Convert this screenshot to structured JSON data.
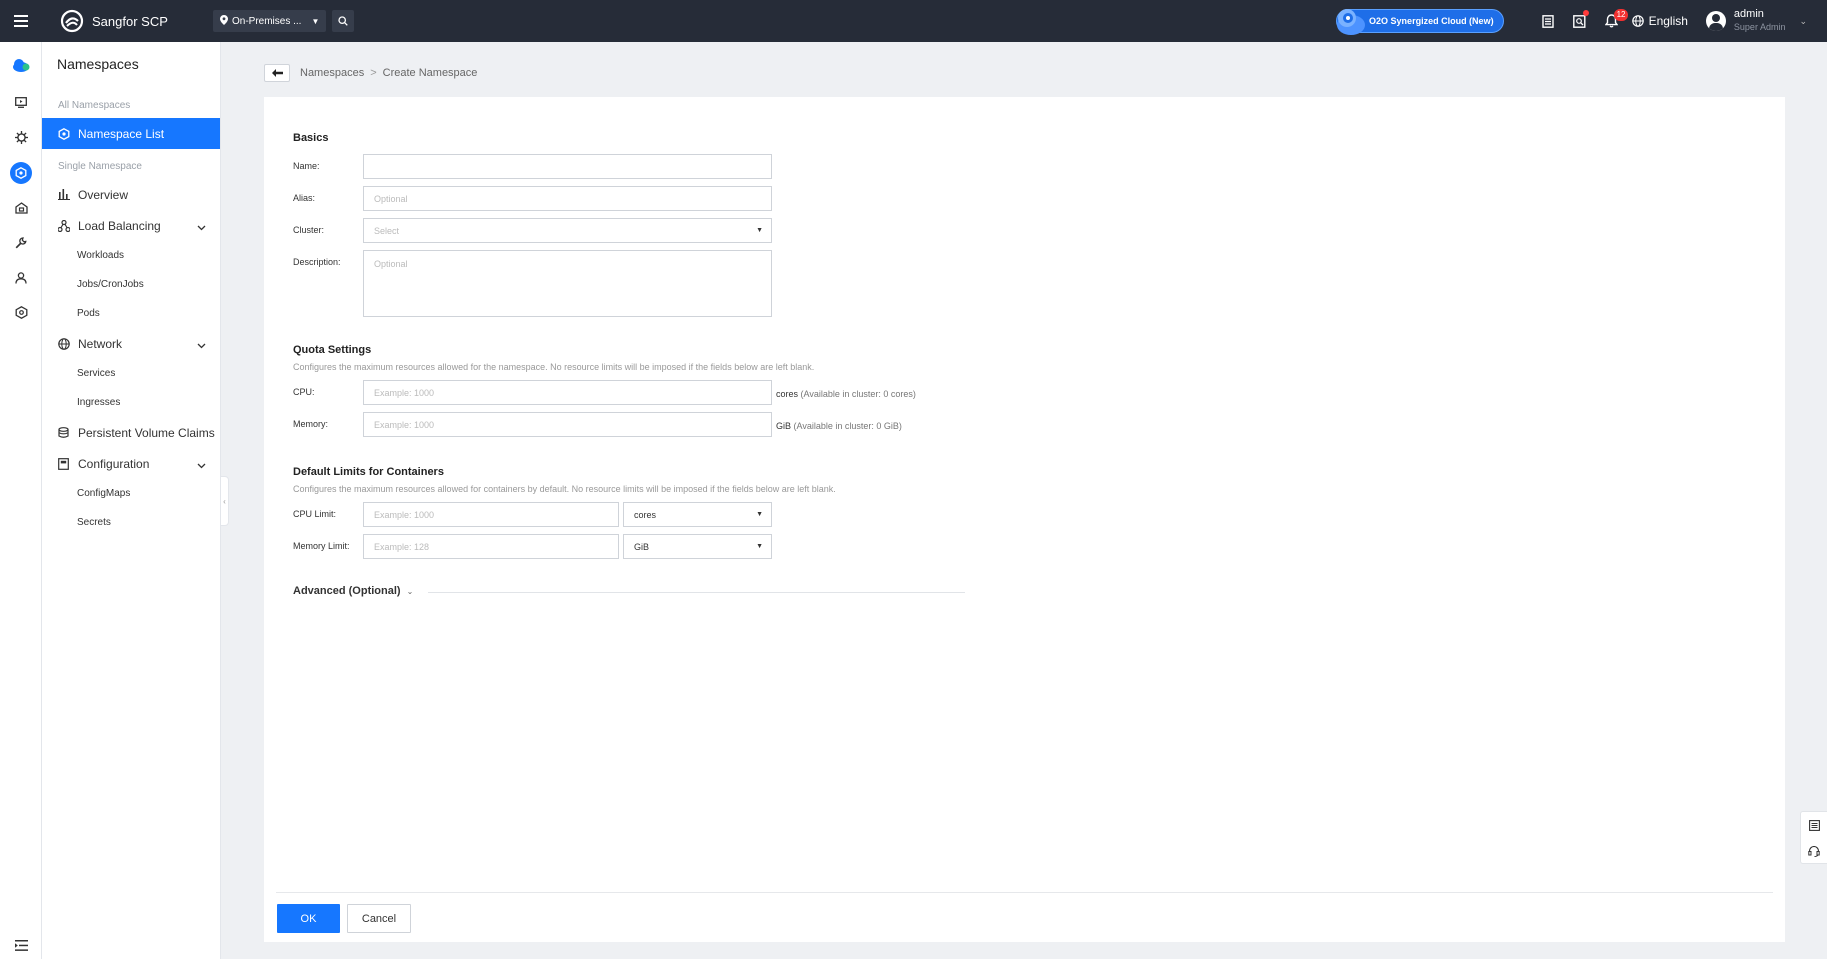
{
  "topbar": {
    "brand": "Sangfor SCP",
    "env_select": "On-Premises ...",
    "o2o_badge": "O2O Synergized Cloud (New)",
    "alert_count": "12",
    "language": "English",
    "user_name": "admin",
    "user_role": "Super Admin"
  },
  "sidebar": {
    "title": "Namespaces",
    "section_all": "All Namespaces",
    "namespace_list": "Namespace List",
    "section_single": "Single Namespace",
    "overview": "Overview",
    "load_balancing": "Load Balancing",
    "workloads": "Workloads",
    "jobs": "Jobs/CronJobs",
    "pods": "Pods",
    "network": "Network",
    "services": "Services",
    "ingresses": "Ingresses",
    "pvc": "Persistent Volume Claims",
    "configuration": "Configuration",
    "configmaps": "ConfigMaps",
    "secrets": "Secrets"
  },
  "breadcrumb": {
    "parent": "Namespaces",
    "separator": ">",
    "current": "Create Namespace"
  },
  "form": {
    "basics": {
      "title": "Basics",
      "name_label": "Name:",
      "name_value": "",
      "alias_label": "Alias:",
      "alias_placeholder": "Optional",
      "cluster_label": "Cluster:",
      "cluster_placeholder": "Select",
      "description_label": "Description:",
      "description_placeholder": "Optional"
    },
    "quota": {
      "title": "Quota Settings",
      "desc": "Configures the maximum resources allowed for the namespace. No resource limits will be imposed if the fields below are left blank.",
      "cpu_label": "CPU:",
      "cpu_placeholder": "Example: 1000",
      "cpu_unit": "cores",
      "cpu_available": "(Available in cluster: 0 cores)",
      "memory_label": "Memory:",
      "memory_placeholder": "Example: 1000",
      "memory_unit": "GiB",
      "memory_available": "(Available in cluster: 0 GiB)"
    },
    "limits": {
      "title": "Default Limits for Containers",
      "desc": "Configures the maximum resources allowed for containers by default. No resource limits will be imposed if the fields below are left blank.",
      "cpu_limit_label": "CPU Limit:",
      "cpu_limit_placeholder": "Example: 1000",
      "cpu_limit_unit": "cores",
      "memory_limit_label": "Memory Limit:",
      "memory_limit_placeholder": "Example: 128",
      "memory_limit_unit": "GiB"
    },
    "advanced": "Advanced (Optional)",
    "ok": "OK",
    "cancel": "Cancel"
  },
  "colors": {
    "accent": "#1677ff",
    "topbar": "#262c38",
    "alert": "#f23030"
  }
}
